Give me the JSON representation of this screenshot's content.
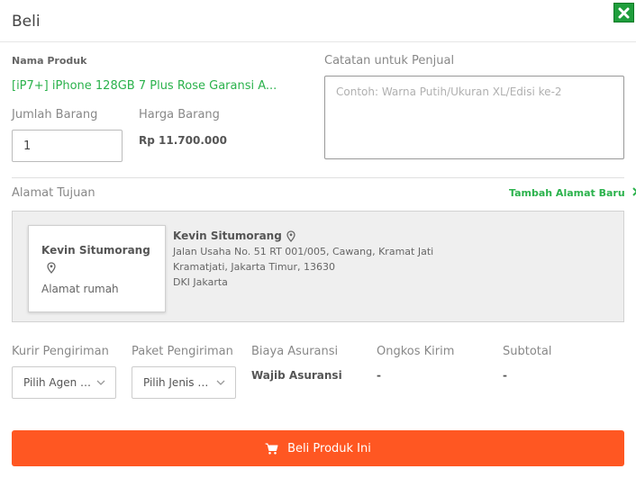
{
  "header": {
    "title": "Beli"
  },
  "product": {
    "name_label": "Nama Produk",
    "name": "[iP7+] iPhone 128GB 7 Plus Rose Garansi A...",
    "qty_label": "Jumlah Barang",
    "qty_value": "1",
    "price_label": "Harga Barang",
    "price": "Rp 11.700.000"
  },
  "notes": {
    "label": "Catatan untuk Penjual",
    "placeholder": "Contoh: Warna Putih/Ukuran XL/Edisi ke-2"
  },
  "address": {
    "section_label": "Alamat Tujuan",
    "add_link": "Tambah Alamat Baru",
    "card": {
      "name": "Kevin Situmorang",
      "label": "Alamat rumah"
    },
    "detail": {
      "name": "Kevin Situmorang",
      "line1": "Jalan Usaha No. 51 RT 001/005, Cawang, Kramat Jati",
      "line2": "Kramatjati,  Jakarta Timur,  13630",
      "line3": "DKI Jakarta"
    }
  },
  "shipping": {
    "courier_label": "Kurir Pengiriman",
    "courier_value": "Pilih Agen Kurir",
    "package_label": "Paket Pengiriman",
    "package_value": "Pilih Jenis Paket",
    "insurance_label": "Biaya Asuransi",
    "insurance_value": "Wajib Asuransi",
    "cost_label": "Ongkos Kirim",
    "cost_value": "-",
    "subtotal_label": "Subtotal",
    "subtotal_value": "-"
  },
  "actions": {
    "buy_label": "Beli Produk Ini"
  },
  "icons": {
    "close": "close-icon",
    "pin": "map-pin-icon",
    "chevron": "chevron-down-icon",
    "cart": "cart-icon",
    "arrow": "chevron-right-icon"
  },
  "colors": {
    "accent_green": "#2bb24c",
    "close_bg": "#1f9e3c",
    "buy_button": "#ff5722"
  }
}
